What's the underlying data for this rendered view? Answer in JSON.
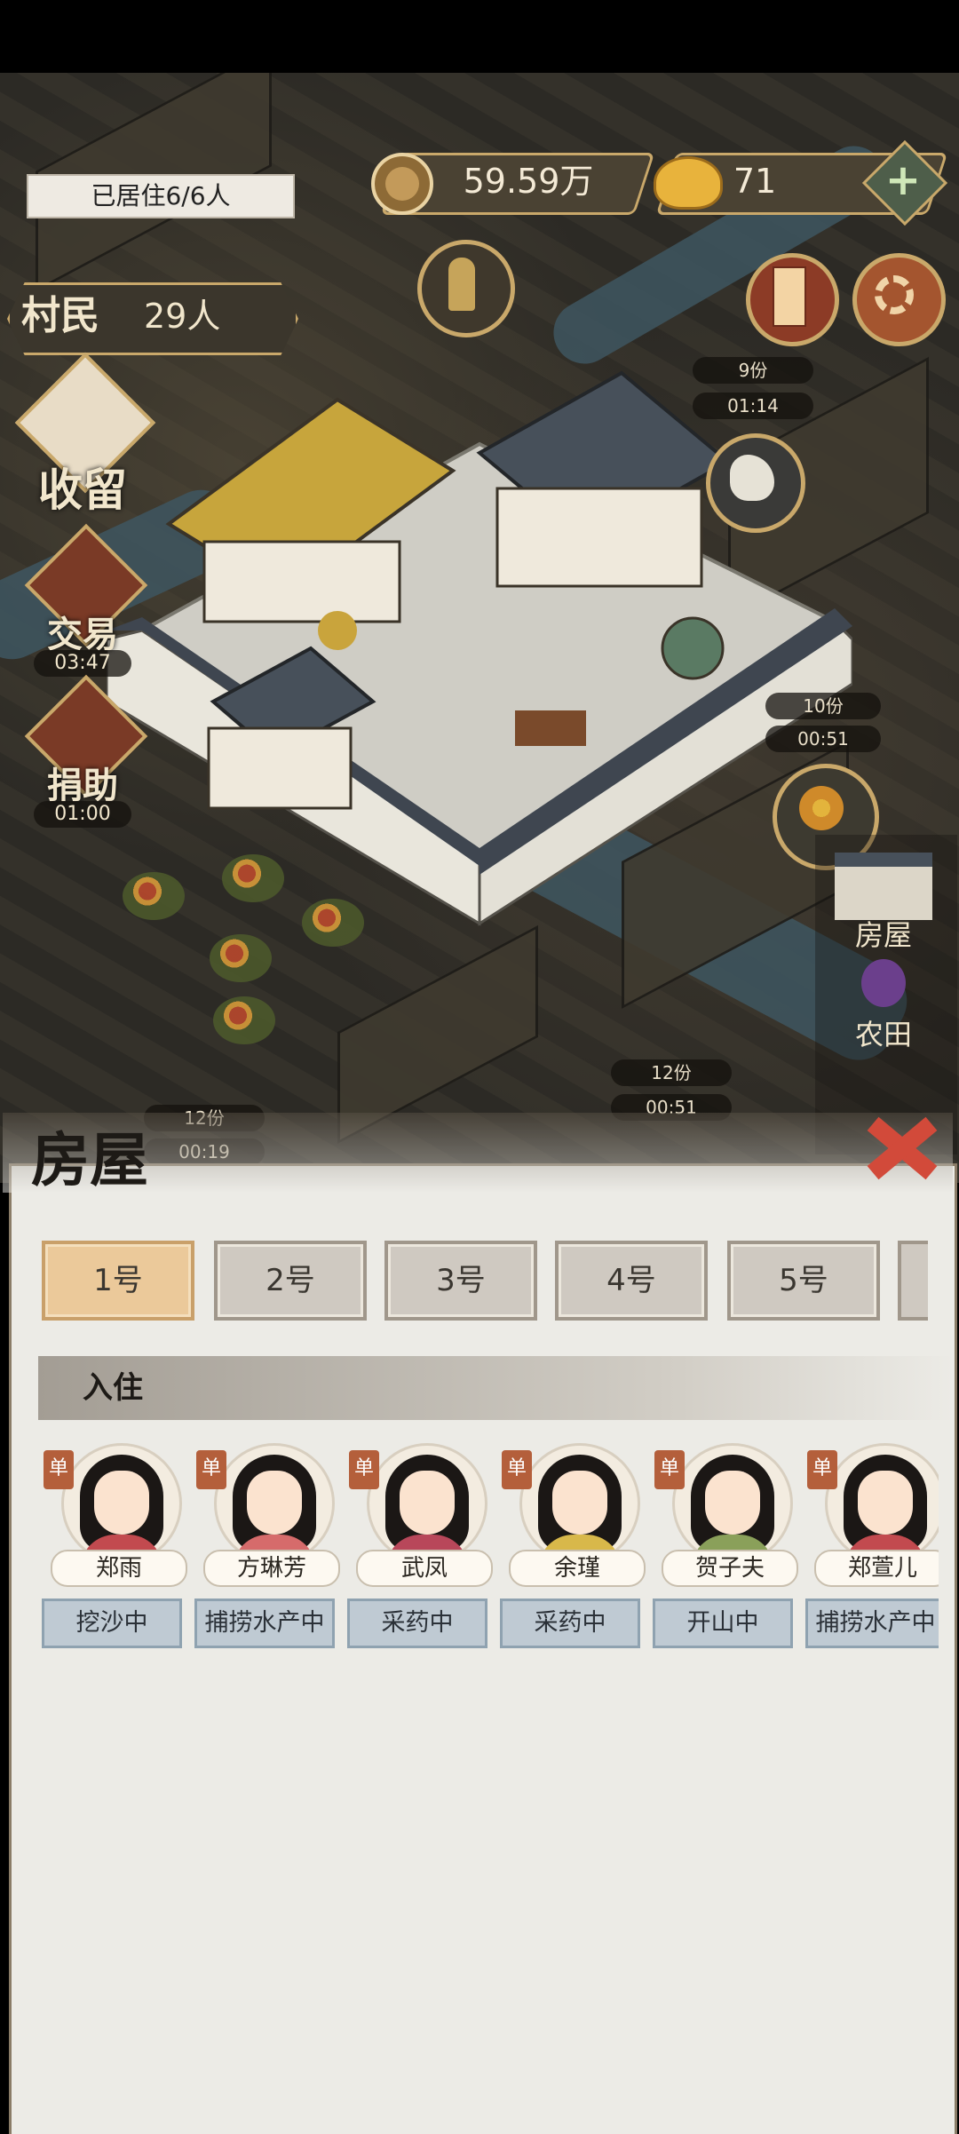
{
  "status_bar": {
    "background": "#000000"
  },
  "top": {
    "residents_label": "已居住6/6人",
    "coins": "59.59万",
    "gold": "71",
    "villagers_label": "村民",
    "villagers_count": "29人"
  },
  "left_menu": {
    "shelter": "收留",
    "trade": "交易",
    "trade_timer": "03:47",
    "donate": "捐助",
    "donate_timer": "01:00"
  },
  "map_badges": [
    {
      "qty": "9份",
      "time": "01:14"
    },
    {
      "qty": "10份",
      "time": "00:51"
    },
    {
      "qty": "12份",
      "time": "00:51"
    },
    {
      "qty": "12份",
      "time": "00:19"
    }
  ],
  "right_menu": {
    "house": "房屋",
    "farm": "农田"
  },
  "panel": {
    "title": "房屋",
    "tabs": [
      "1号",
      "2号",
      "3号",
      "4号",
      "5号"
    ],
    "active_tab": 0,
    "section_title": "入住",
    "single_badge": "单",
    "residents": [
      {
        "name": "郑雨",
        "job": "挖沙中"
      },
      {
        "name": "方琳芳",
        "job": "捕捞水产中"
      },
      {
        "name": "武凤",
        "job": "采药中"
      },
      {
        "name": "余瑾",
        "job": "采药中"
      },
      {
        "name": "贺子夫",
        "job": "开山中"
      },
      {
        "name": "郑萱儿",
        "job": "捕捞水产中"
      }
    ]
  },
  "colors": {
    "accent": "#c9a86a",
    "active_tab": "#ebc99a",
    "job_bg": "#bfcad3",
    "panel_bg": "#ecebe6"
  }
}
